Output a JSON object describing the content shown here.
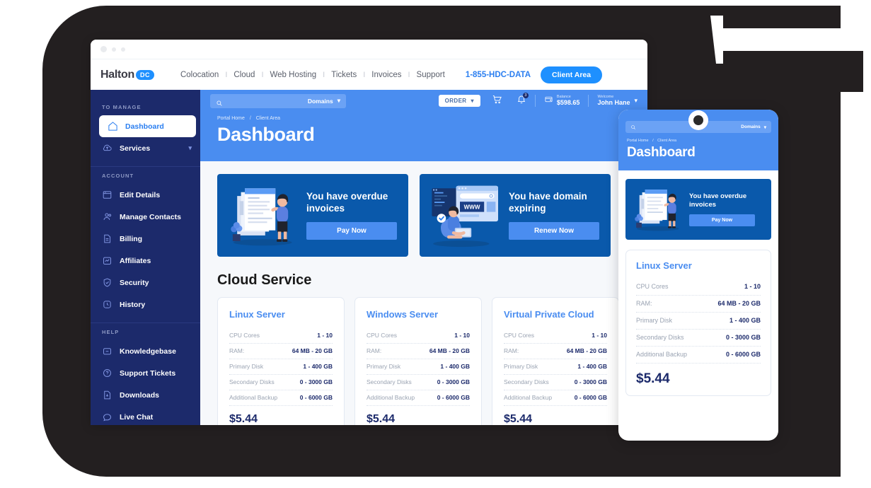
{
  "window": {
    "dots": [
      "close-dot",
      "minimize-dot",
      "maximize-dot"
    ]
  },
  "topnav": {
    "logo_text": "Halton",
    "logo_badge": "DC",
    "links": [
      "Colocation",
      "Cloud",
      "Web Hosting",
      "Tickets",
      "Invoices",
      "Support"
    ],
    "separator": "I",
    "phone": "1-855-HDC-DATA",
    "client_area": "Client Area"
  },
  "utilbar": {
    "search_placeholder": "",
    "domains_label": "Domains",
    "order_label": "ORDER",
    "cart_count": "",
    "bell_count": "3",
    "balance_label": "Balance",
    "balance_value": "$598.65",
    "welcome_label": "Welcome",
    "welcome_user": "John Hane"
  },
  "sidebar": {
    "groups": [
      {
        "label": "TO MANAGE",
        "items": [
          {
            "label": "Dashboard",
            "icon": "home-icon",
            "active": true
          },
          {
            "label": "Services",
            "icon": "cloud-upload-icon",
            "chevron": true
          }
        ]
      },
      {
        "label": "ACCOUNT",
        "items": [
          {
            "label": "Edit Details",
            "icon": "window-icon"
          },
          {
            "label": "Manage Contacts",
            "icon": "people-icon"
          },
          {
            "label": "Billing",
            "icon": "document-icon"
          },
          {
            "label": "Affiliates",
            "icon": "chart-icon"
          },
          {
            "label": "Security",
            "icon": "shield-check-icon"
          },
          {
            "label": "History",
            "icon": "clock-icon"
          }
        ]
      },
      {
        "label": "HELP",
        "items": [
          {
            "label": "Knowledgebase",
            "icon": "folder-icon"
          },
          {
            "label": "Support Tickets",
            "icon": "question-icon"
          },
          {
            "label": "Downloads",
            "icon": "download-icon"
          },
          {
            "label": "Live Chat",
            "icon": "chat-icon"
          }
        ]
      }
    ]
  },
  "breadcrumb": {
    "home": "Portal Home",
    "sep": "/",
    "current": "Client Area"
  },
  "page_title": "Dashboard",
  "alerts": [
    {
      "title": "You have overdue invoices",
      "button": "Pay Now",
      "art": "invoice-woman-illustration"
    },
    {
      "title": "You have domain expiring",
      "button": "Renew Now",
      "art": "domain-browser-illustration"
    }
  ],
  "section_title": "Cloud Service",
  "spec_keys": [
    "CPU Cores",
    "RAM:",
    "Primary Disk",
    "Secondary Disks",
    "Additional Backup"
  ],
  "plans": [
    {
      "name": "Linux Server",
      "specs": [
        "1 - 10",
        "64 MB - 20 GB",
        "1 - 400 GB",
        "0 - 3000 GB",
        "0 - 6000 GB"
      ],
      "price": "$5.44"
    },
    {
      "name": "Windows Server",
      "specs": [
        "1 - 10",
        "64 MB - 20 GB",
        "1 - 400 GB",
        "0 - 3000 GB",
        "0 - 6000 GB"
      ],
      "price": "$5.44"
    },
    {
      "name": "Virtual Private Cloud",
      "specs": [
        "1 - 10",
        "64 MB - 20 GB",
        "1 - 400 GB",
        "0 - 3000 GB",
        "0 - 6000 GB"
      ],
      "price": "$5.44"
    }
  ],
  "tablet": {
    "domains_label": "Domains",
    "breadcrumb": {
      "home": "Portal Home",
      "sep": "/",
      "current": "Client Area"
    },
    "page_title": "Dashboard",
    "alert": {
      "title": "You have overdue invoices",
      "button": "Pay Now"
    },
    "plan": {
      "name": "Linux Server",
      "specs": [
        "1 - 10",
        "64 MB - 20 GB",
        "1 - 400 GB",
        "0 - 3000 GB",
        "0 - 6000 GB"
      ],
      "price": "$5.44"
    }
  },
  "colors": {
    "brand_blue": "#1e90ff",
    "header_blue": "#4a8df0",
    "sidebar_navy": "#1c2a6b",
    "card_blue": "#0a59ab",
    "device_dark": "#231f20"
  }
}
